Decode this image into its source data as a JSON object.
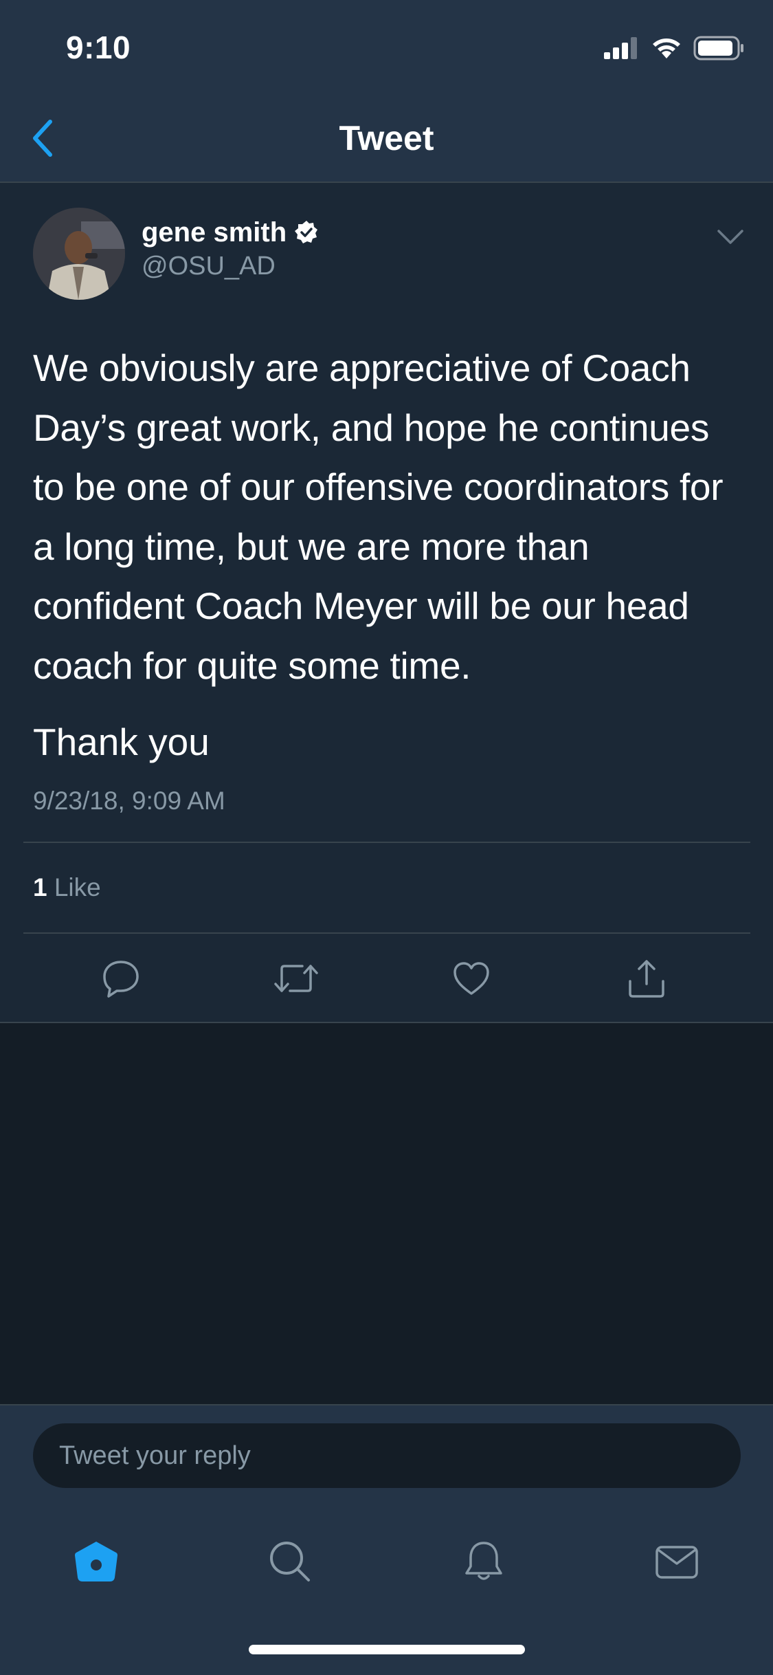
{
  "status_bar": {
    "time": "9:10",
    "icons": [
      "cellular-signal-icon",
      "wifi-icon",
      "battery-icon"
    ]
  },
  "nav": {
    "back_icon": "chevron-left-icon",
    "title": "Tweet"
  },
  "tweet": {
    "author": {
      "name": "gene smith",
      "handle": "@OSU_AD",
      "verified": true
    },
    "text_lines": [
      "We obviously are appreciative of Coach",
      "Day’s great work, and hope he continues",
      "to be one of our offensive coordinators for",
      "a long time, but we are more than",
      "confident Coach Meyer will be our head",
      "coach for quite some time."
    ],
    "text_closing": "Thank you",
    "timestamp": "9/23/18, 9:09 AM",
    "likes_count": "1",
    "likes_label": "Like",
    "actions": [
      "reply-icon",
      "retweet-icon",
      "like-icon",
      "share-icon"
    ]
  },
  "reply": {
    "placeholder": "Tweet your reply"
  },
  "tab_bar": {
    "tabs": [
      "home-icon",
      "search-icon",
      "notifications-icon",
      "messages-icon"
    ],
    "active": "home-icon"
  },
  "colors": {
    "accent": "#1da1f2",
    "background": "#141d26",
    "card": "#1b2836",
    "bar": "#243447",
    "secondary_text": "#8899a6",
    "divider": "#38444d"
  }
}
